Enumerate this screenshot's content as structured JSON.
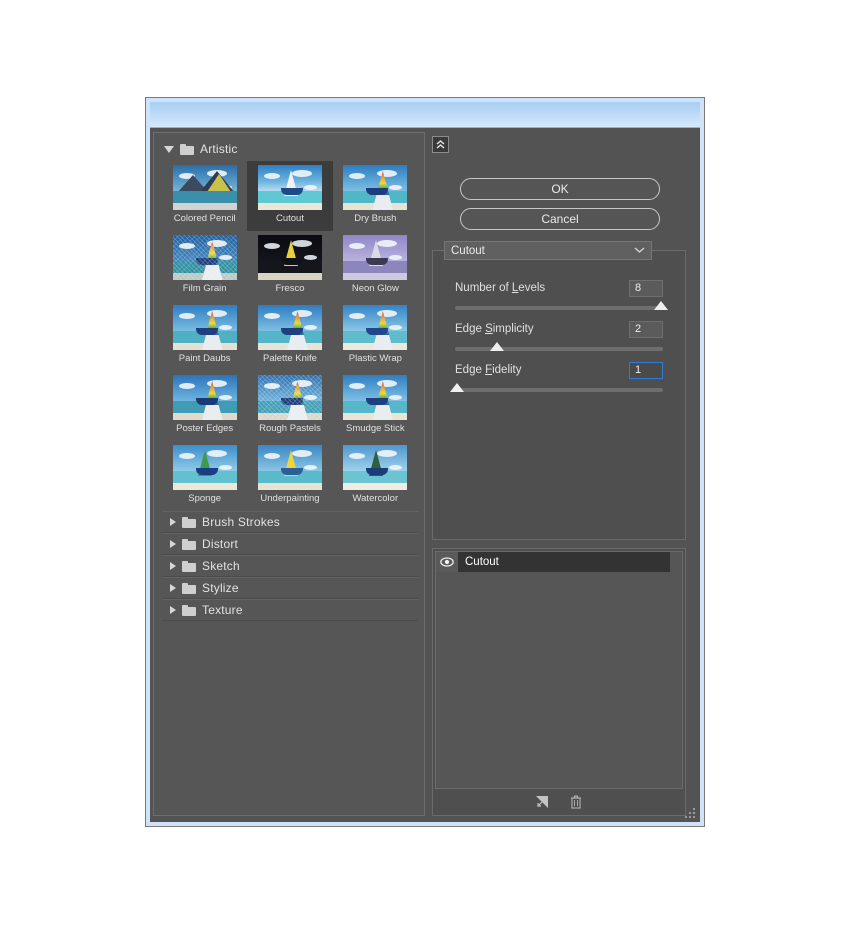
{
  "window": {
    "title": "",
    "resize_grip_name": "resize-grip"
  },
  "filter_browser": {
    "expanded_category": {
      "label": "Artistic",
      "disclosure_state": "open"
    },
    "thumbnails": [
      {
        "label": "Colored Pencil",
        "selected": false,
        "style": "pencil"
      },
      {
        "label": "Cutout",
        "selected": true,
        "style": "cutout"
      },
      {
        "label": "Dry Brush",
        "selected": false,
        "style": "drybrush"
      },
      {
        "label": "Film Grain",
        "selected": false,
        "style": "filmgrain"
      },
      {
        "label": "Fresco",
        "selected": false,
        "style": "fresco"
      },
      {
        "label": "Neon Glow",
        "selected": false,
        "style": "neon"
      },
      {
        "label": "Paint Daubs",
        "selected": false,
        "style": "daubs"
      },
      {
        "label": "Palette Knife",
        "selected": false,
        "style": "knife"
      },
      {
        "label": "Plastic Wrap",
        "selected": false,
        "style": "plastic"
      },
      {
        "label": "Poster Edges",
        "selected": false,
        "style": "poster"
      },
      {
        "label": "Rough Pastels",
        "selected": false,
        "style": "pastels"
      },
      {
        "label": "Smudge Stick",
        "selected": false,
        "style": "smudge"
      },
      {
        "label": "Sponge",
        "selected": false,
        "style": "sponge"
      },
      {
        "label": "Underpainting",
        "selected": false,
        "style": "underpaint"
      },
      {
        "label": "Watercolor",
        "selected": false,
        "style": "watercolor"
      }
    ],
    "collapsed_categories": [
      {
        "label": "Brush Strokes"
      },
      {
        "label": "Distort"
      },
      {
        "label": "Sketch"
      },
      {
        "label": "Stylize"
      },
      {
        "label": "Texture"
      }
    ]
  },
  "right_panel": {
    "collapse_button_icon": "double-chevron-up-icon",
    "ok_label": "OK",
    "cancel_label": "Cancel",
    "filter_select": {
      "value": "Cutout",
      "chevron_icon": "chevron-down-icon"
    },
    "parameters": [
      {
        "label_before": "Number of ",
        "label_mnemonic": "L",
        "label_after": "evels",
        "value": "8",
        "slider_percent": 99,
        "focused": false
      },
      {
        "label_before": "Edge ",
        "label_mnemonic": "S",
        "label_after": "implicity",
        "value": "2",
        "slider_percent": 20,
        "focused": false
      },
      {
        "label_before": "Edge ",
        "label_mnemonic": "F",
        "label_after": "idelity",
        "value": "1",
        "slider_percent": 1,
        "focused": true
      }
    ]
  },
  "effects_panel": {
    "layers": [
      {
        "name": "Cutout",
        "visible": true,
        "visibility_icon": "eye-icon"
      }
    ],
    "toolbar": [
      {
        "icon": "new-effect-layer-icon"
      },
      {
        "icon": "trash-icon"
      }
    ]
  },
  "colors": {
    "dialog_background": "#535353",
    "panel_background": "#4f4f4f",
    "titlebar_accent": "#bcd9f7",
    "focus_border": "#2d7dd2",
    "selected_item": "#3c3c3c",
    "text": "#e2e2e2"
  }
}
